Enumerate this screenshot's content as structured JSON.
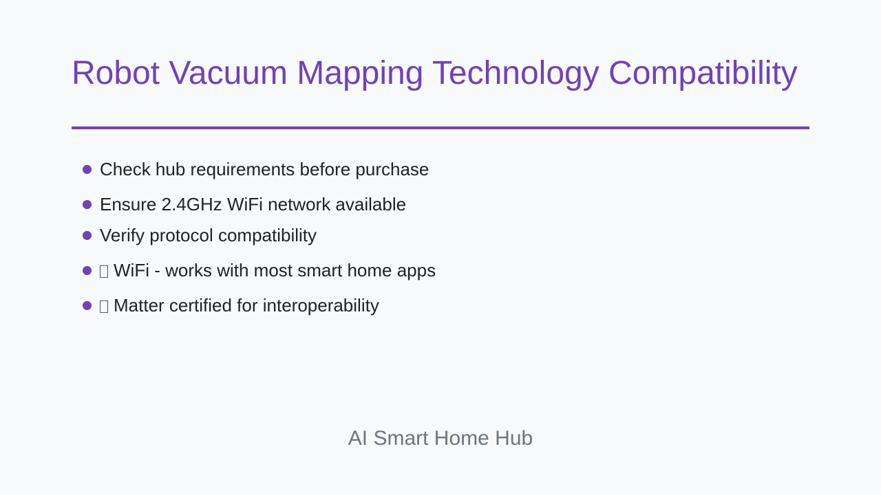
{
  "slide": {
    "title": "Robot Vacuum Mapping Technology Compatibility",
    "bullets": [
      {
        "text": "Check hub requirements before purchase",
        "has_glyph": false
      },
      {
        "text": "Ensure 2.4GHz WiFi network available",
        "has_glyph": false
      },
      {
        "text": "Verify protocol compatibility",
        "has_glyph": false
      },
      {
        "text": "WiFi - works with most smart home apps",
        "has_glyph": true
      },
      {
        "text": "Matter certified for interoperability",
        "has_glyph": true
      }
    ],
    "footer": "AI Smart Home Hub"
  },
  "colors": {
    "accent": "#6f42b8",
    "background": "#f8f9fb",
    "text": "#222222",
    "footer": "#6c757d"
  }
}
